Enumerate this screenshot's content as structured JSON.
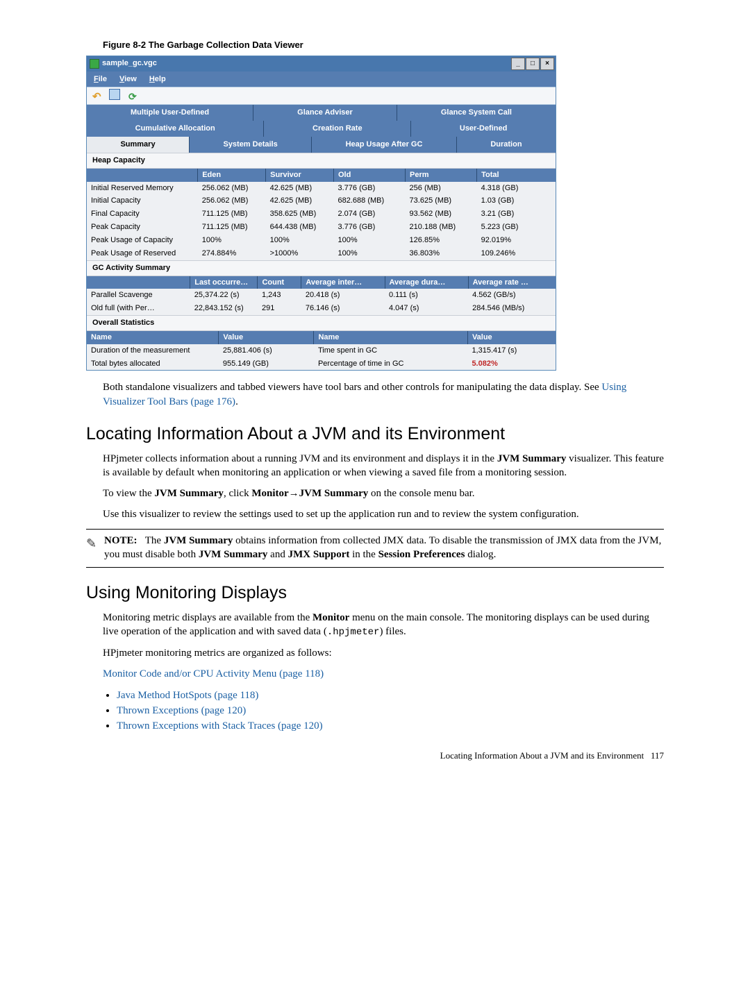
{
  "figure_title": "Figure 8-2 The Garbage Collection Data Viewer",
  "app": {
    "title": "sample_gc.vgc",
    "menu": {
      "file": "File",
      "view": "View",
      "help": "Help"
    },
    "tabs_row1": [
      "Multiple User-Defined",
      "Glance Adviser",
      "Glance System Call"
    ],
    "tabs_row2": [
      "Cumulative Allocation",
      "Creation Rate",
      "User-Defined"
    ],
    "tabs_row3": [
      "Summary",
      "System Details",
      "Heap Usage After GC",
      "Duration"
    ],
    "heap": {
      "section": "Heap Capacity",
      "headers": [
        "",
        "Eden",
        "Survivor",
        "Old",
        "Perm",
        "Total"
      ],
      "rows": [
        [
          "Initial Reserved Memory",
          "256.062 (MB)",
          "42.625 (MB)",
          "3.776 (GB)",
          "256 (MB)",
          "4.318 (GB)"
        ],
        [
          "Initial Capacity",
          "256.062 (MB)",
          "42.625 (MB)",
          "682.688 (MB)",
          "73.625 (MB)",
          "1.03 (GB)"
        ],
        [
          "Final Capacity",
          "711.125 (MB)",
          "358.625 (MB)",
          "2.074 (GB)",
          "93.562 (MB)",
          "3.21 (GB)"
        ],
        [
          "Peak Capacity",
          "711.125 (MB)",
          "644.438 (MB)",
          "3.776 (GB)",
          "210.188 (MB)",
          "5.223 (GB)"
        ],
        [
          "Peak Usage of Capacity",
          "100%",
          "100%",
          "100%",
          "126.85%",
          "92.019%"
        ],
        [
          "Peak Usage of Reserved",
          "274.884%",
          ">1000%",
          "100%",
          "36.803%",
          "109.246%"
        ]
      ]
    },
    "gc": {
      "section": "GC Activity Summary",
      "headers": [
        "",
        "Last occurre…",
        "Count",
        "Average inter…",
        "Average dura…",
        "Average rate …"
      ],
      "rows": [
        [
          "Parallel Scavenge",
          "25,374.22 (s)",
          "1,243",
          "20.418 (s)",
          "0.111 (s)",
          "4.562 (GB/s)"
        ],
        [
          "Old full (with Per…",
          "22,843.152 (s)",
          "291",
          "76.146 (s)",
          "4.047 (s)",
          "284.546 (MB/s)"
        ]
      ]
    },
    "stats": {
      "section": "Overall Statistics",
      "headers": [
        "Name",
        "Value",
        "Name",
        "Value"
      ],
      "rows": [
        [
          "Duration of the measurement",
          "25,881.406 (s)",
          "Time spent in GC",
          "1,315.417 (s)"
        ],
        [
          "Total bytes allocated",
          "955.149 (GB)",
          "Percentage of time in GC",
          "5.082%"
        ]
      ]
    }
  },
  "doc": {
    "after_figure": "Both standalone visualizers and tabbed viewers have tool bars and other controls for manipulating the data display. See ",
    "after_figure_link": "Using Visualizer Tool Bars (page 176)",
    "after_figure_end": ".",
    "h2a": "Locating Information About a JVM and its Environment",
    "p1a": "HPjmeter collects information about a running JVM and its environment and displays it in the ",
    "jvm_summary": "JVM Summary",
    "p1b": " visualizer. This feature is available by default when monitoring an application or when viewing a saved file from a monitoring session.",
    "p2a": "To view the ",
    "p2b": ", click ",
    "monitor_path": "Monitor→JVM Summary",
    "p2c": " on the console menu bar.",
    "p3": "Use this visualizer to review the settings used to set up the application run and to review the system configuration.",
    "note_label": "NOTE:",
    "note_1": "The ",
    "note_2": " obtains information from collected JMX data. To disable the transmission of JMX data from the JVM, you must disable both ",
    "jmx_support": "JMX Support",
    "note_3": " and ",
    "note_4": " in the ",
    "session_pref": "Session Preferences",
    "note_5": " dialog.",
    "h2b": "Using Monitoring Displays",
    "p4a": "Monitoring metric displays are available from the ",
    "monitor_word": "Monitor",
    "p4b": " menu on the main console. The monitoring displays can be used during live operation of the application and with saved data (",
    "hpjmeter_file": ".hpjmeter",
    "p4c": ") files.",
    "p5": "HPjmeter monitoring metrics are organized as follows:",
    "monitor_menu_link": "Monitor Code and/or CPU Activity Menu (page 118)",
    "bullets": [
      "Java Method HotSpots (page 118)",
      "Thrown Exceptions (page 120)",
      "Thrown Exceptions with Stack Traces (page 120)"
    ],
    "footer_text": "Locating Information About a JVM and its Environment",
    "footer_page": "117"
  }
}
